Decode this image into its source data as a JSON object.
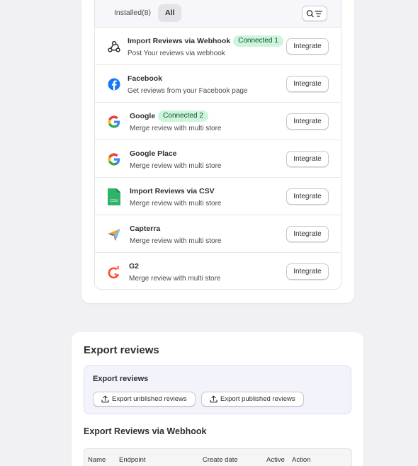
{
  "tabs": {
    "installed": "Installed(8)",
    "all": "All"
  },
  "integrations": [
    {
      "title": "Import Reviews via Webhook",
      "badge": "Connected 1",
      "desc": "Post Your reviews via webhook",
      "button": "Integrate",
      "icon": "webhook-icon"
    },
    {
      "title": "Facebook",
      "badge": "",
      "desc": "Get reviews from your Facebook page",
      "button": "Integrate",
      "icon": "facebook-icon"
    },
    {
      "title": "Google",
      "badge": "Connected 2",
      "desc": "Merge review with multi store",
      "button": "Integrate",
      "icon": "google-icon"
    },
    {
      "title": "Google Place",
      "badge": "",
      "desc": "Merge review with multi store",
      "button": "Integrate",
      "icon": "google-icon"
    },
    {
      "title": "Import Reviews via CSV",
      "badge": "",
      "desc": "Merge review with multi store",
      "button": "Integrate",
      "icon": "csv-file-icon",
      "icon_text": "CSV"
    },
    {
      "title": "Capterra",
      "badge": "",
      "desc": "Merge review with multi store",
      "button": "Integrate",
      "icon": "capterra-icon"
    },
    {
      "title": "G2",
      "badge": "",
      "desc": "Merge review with multi store",
      "button": "Integrate",
      "icon": "g2-icon"
    }
  ],
  "export": {
    "heading": "Export reviews",
    "box_title": "Export reviews",
    "unpublished_label": "Export unblished reviews",
    "published_label": "Export published reviews"
  },
  "webhook": {
    "heading": "Export Reviews via Webhook",
    "columns": [
      "Name",
      "Endpoint",
      "Create date",
      "Active",
      "Action"
    ]
  },
  "colors": {
    "badge_bg": "#cdf5dc",
    "badge_text": "#0c5132",
    "facebook": "#1877f2",
    "csv_green": "#2fb36a",
    "g2_red": "#ff492c"
  }
}
